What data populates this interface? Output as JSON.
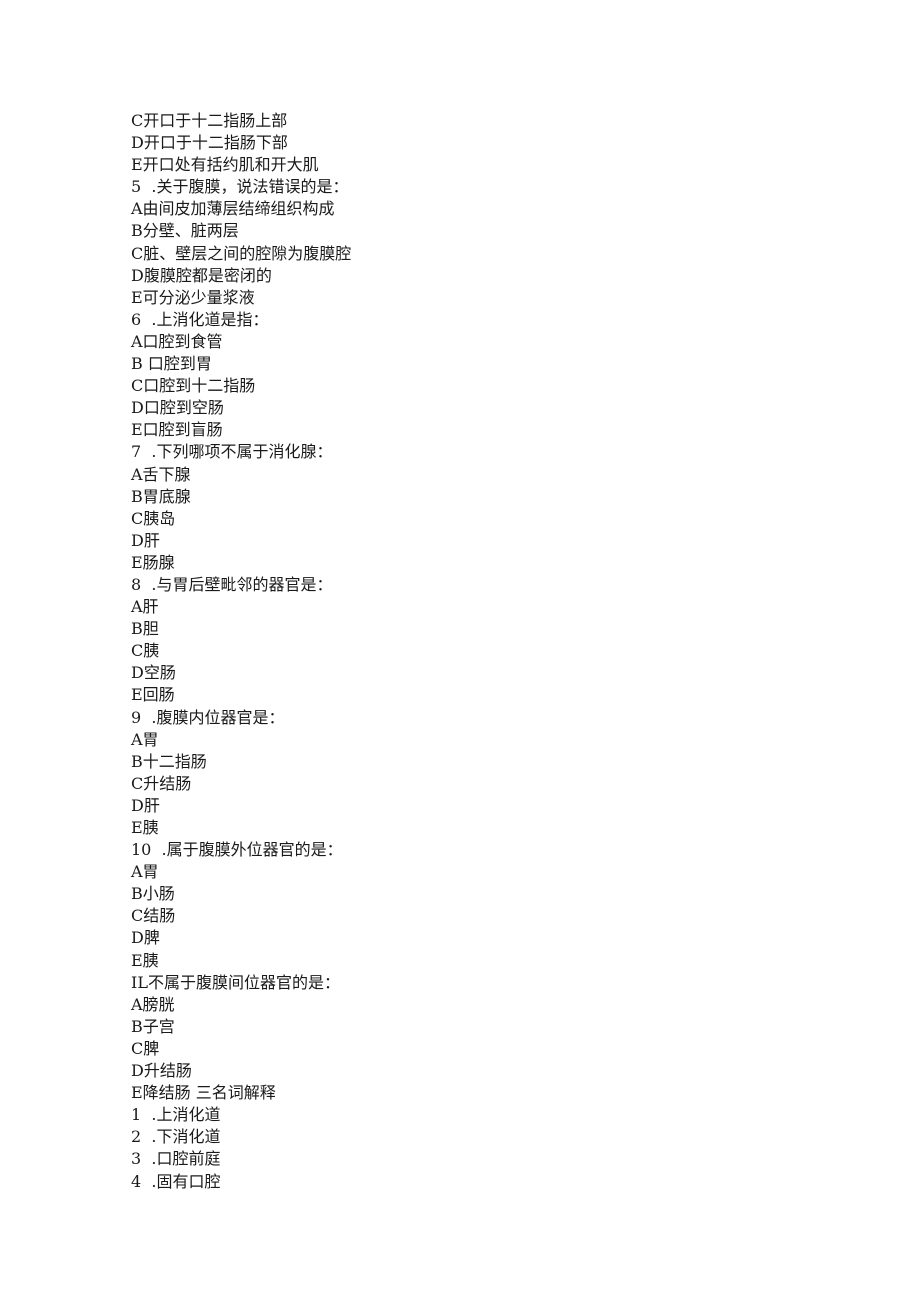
{
  "lines": [
    "C开口于十二指肠上部",
    "D开口于十二指肠下部",
    "E开口处有括约肌和开大肌",
    "5  .关于腹膜，说法错误的是：",
    "A由间皮加薄层结缔组织构成",
    "B分壁、脏两层",
    "C脏、壁层之间的腔隙为腹膜腔",
    "D腹膜腔都是密闭的",
    "E可分泌少量浆液",
    "6  .上消化道是指：",
    "A口腔到食管",
    "B 口腔到胃",
    "C口腔到十二指肠",
    "D口腔到空肠",
    "E口腔到盲肠",
    "7  .下列哪项不属于消化腺：",
    "A舌下腺",
    "B胃底腺",
    "C胰岛",
    "D肝",
    "E肠腺",
    "8  .与胃后壁毗邻的器官是：",
    "A肝",
    "B胆",
    "C胰",
    "D空肠",
    "E回肠",
    "9  .腹膜内位器官是：",
    "A胃",
    "B十二指肠",
    "C升结肠",
    "D肝",
    "E胰",
    "10  .属于腹膜外位器官的是：",
    "A胃",
    "B小肠",
    "C结肠",
    "D脾",
    "E胰",
    "IL不属于腹膜间位器官的是：",
    "A膀胱",
    "B子宫",
    "C脾",
    "D升结肠",
    "E降结肠 三名词解释",
    "1  .上消化道",
    "2  .下消化道",
    "3  .口腔前庭",
    "4  .固有口腔"
  ]
}
